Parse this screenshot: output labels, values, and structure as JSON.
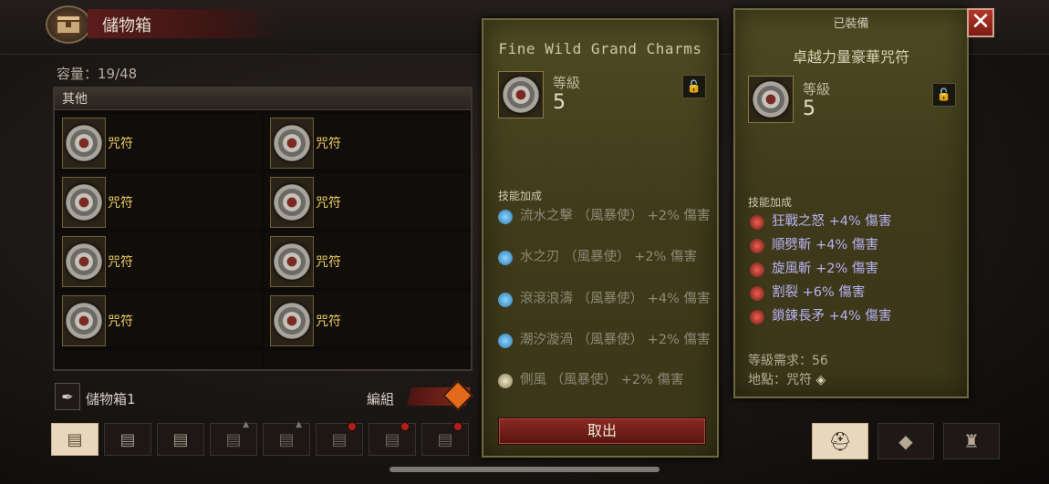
{
  "stash": {
    "title": "儲物箱",
    "capacity": "容量：19/48",
    "section_header": "其他",
    "items": [
      {
        "label": "咒符"
      },
      {
        "label": "咒符"
      },
      {
        "label": "咒符"
      },
      {
        "label": "咒符"
      },
      {
        "label": "咒符"
      },
      {
        "label": "咒符"
      },
      {
        "label": "咒符"
      },
      {
        "label": "咒符"
      }
    ],
    "name": "儲物箱1",
    "edit_label": "編組",
    "tabs": [
      {
        "state": "active"
      },
      {
        "state": "normal"
      },
      {
        "state": "normal"
      },
      {
        "state": "locked"
      },
      {
        "state": "locked"
      },
      {
        "state": "badge"
      },
      {
        "state": "badge"
      },
      {
        "state": "badge"
      }
    ]
  },
  "left_tooltip": {
    "title": "Fine Wild Grand Charms",
    "level_label": "等級",
    "level_value": "5",
    "lock_icon": "unlock-icon",
    "skill_header": "技能加成",
    "skills": [
      {
        "text": "流水之擊 （風暴使） +2% 傷害",
        "icon": "water-strike-icon"
      },
      {
        "text": "水之刃 （風暴使） +2% 傷害",
        "icon": "water-blade-icon"
      },
      {
        "text": "滾滾浪濤 （風暴使） +4% 傷害",
        "icon": "rolling-wave-icon"
      },
      {
        "text": "潮汐漩渦 （風暴使） +2% 傷害",
        "icon": "tidal-vortex-icon"
      },
      {
        "text": "側風 （風暴使） +2% 傷害",
        "icon": "crosswind-icon"
      }
    ],
    "take_button": "取出"
  },
  "right_tooltip": {
    "equipped_tag": "已裝備",
    "title": "卓越力量豪華咒符",
    "level_label": "等級",
    "level_value": "5",
    "skill_header": "技能加成",
    "skills": [
      {
        "text": "狂戰之怒 +4% 傷害",
        "icon": "berserk-fury-icon"
      },
      {
        "text": "順劈斬 +4% 傷害",
        "icon": "cleave-icon"
      },
      {
        "text": "旋風斬 +2% 傷害",
        "icon": "whirlwind-icon"
      },
      {
        "text": "割裂 +6% 傷害",
        "icon": "rend-icon"
      },
      {
        "text": "鎖鍊長矛 +4% 傷害",
        "icon": "chain-lance-icon"
      }
    ],
    "level_req": "等級需求：56",
    "location": "地點：咒符"
  },
  "right_tabs": [
    {
      "icon": "helmet-icon",
      "state": "active"
    },
    {
      "icon": "charm-stones-icon",
      "state": "normal"
    },
    {
      "icon": "bag-icon",
      "state": "normal"
    }
  ],
  "close_label": "✕",
  "colors": {
    "accent_gold": "#f0d060",
    "tooltip_bg": "#4e4a22",
    "skill_purple": "#b8b2f0",
    "button_red": "#8a2a22"
  }
}
